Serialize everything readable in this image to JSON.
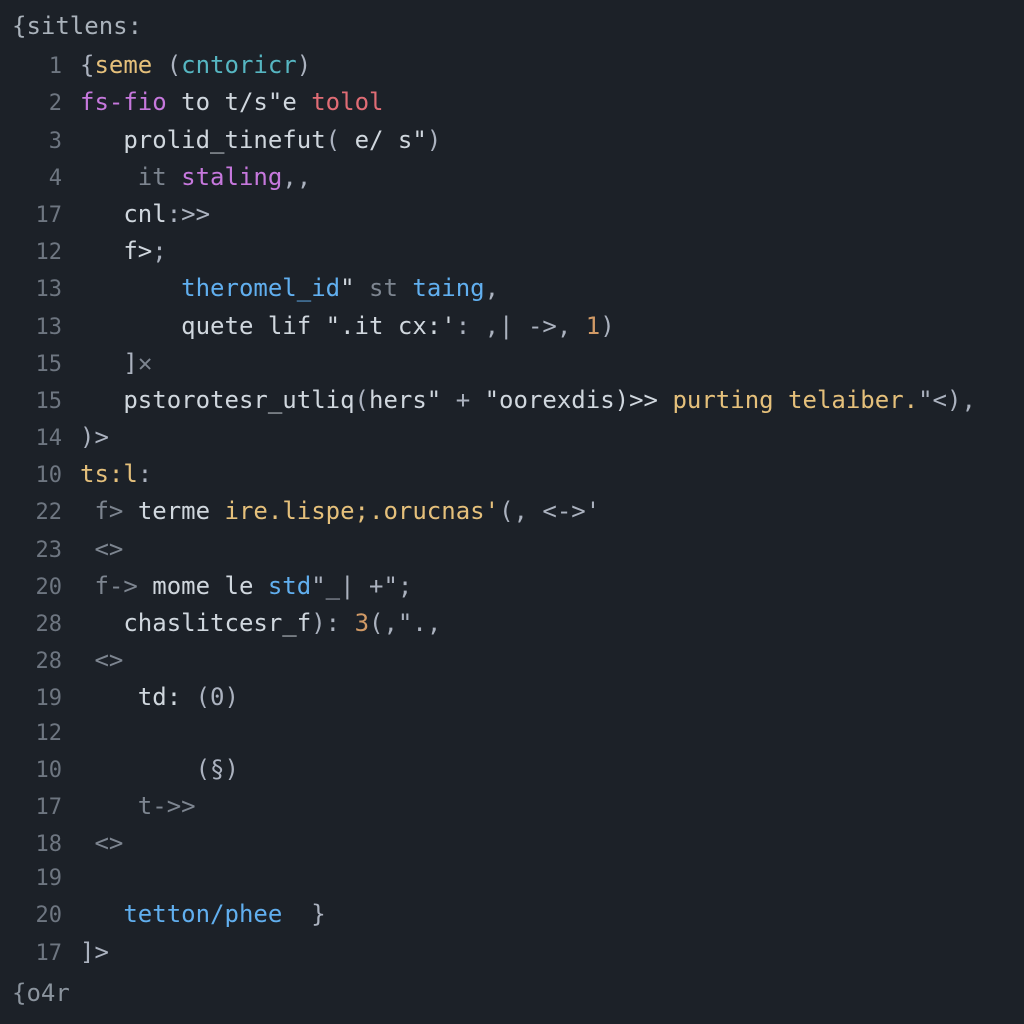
{
  "header": "{sitlens:",
  "footer": "{o4r",
  "lines": [
    {
      "num": "1",
      "indent": "",
      "tokens": [
        {
          "t": "{",
          "cls": "tk-punc"
        },
        {
          "t": "seme ",
          "cls": "tk-fn"
        },
        {
          "t": "(",
          "cls": "tk-punc"
        },
        {
          "t": "cntoricr",
          "cls": "tk-teal"
        },
        {
          "t": ")",
          "cls": "tk-punc"
        }
      ]
    },
    {
      "num": "2",
      "indent": "",
      "tokens": [
        {
          "t": "fs-fio ",
          "cls": "tk-kw"
        },
        {
          "t": "to ",
          "cls": "tk-default"
        },
        {
          "t": "t/s\"e ",
          "cls": "tk-default"
        },
        {
          "t": "tolol",
          "cls": "tk-err"
        }
      ]
    },
    {
      "num": "3",
      "indent": "   ",
      "tokens": [
        {
          "t": "prolid_tinefut",
          "cls": "tk-default"
        },
        {
          "t": "( ",
          "cls": "tk-punc"
        },
        {
          "t": "e/ ",
          "cls": "tk-default"
        },
        {
          "t": "s\"",
          "cls": "tk-default"
        },
        {
          "t": ")",
          "cls": "tk-punc"
        }
      ]
    },
    {
      "num": "4",
      "indent": "    ",
      "tokens": [
        {
          "t": "it ",
          "cls": "tk-dim"
        },
        {
          "t": "staling",
          "cls": "tk-kw"
        },
        {
          "t": ",,",
          "cls": "tk-punc"
        }
      ]
    },
    {
      "num": "17",
      "indent": "   ",
      "tokens": [
        {
          "t": "cnl",
          "cls": "tk-default"
        },
        {
          "t": ":>>",
          "cls": "tk-punc"
        }
      ]
    },
    {
      "num": "12",
      "indent": "   ",
      "tokens": [
        {
          "t": "f>",
          "cls": "tk-default"
        },
        {
          "t": ";",
          "cls": "tk-punc"
        }
      ]
    },
    {
      "num": "13",
      "indent": "       ",
      "tokens": [
        {
          "t": "theromel_id",
          "cls": "tk-blue"
        },
        {
          "t": "\" ",
          "cls": "tk-default"
        },
        {
          "t": "st ",
          "cls": "tk-dim"
        },
        {
          "t": "taing",
          "cls": "tk-blue"
        },
        {
          "t": ",",
          "cls": "tk-punc"
        }
      ]
    },
    {
      "num": "13",
      "indent": "       ",
      "tokens": [
        {
          "t": "quete lif ",
          "cls": "tk-default"
        },
        {
          "t": "\".it cx:'",
          "cls": "tk-default"
        },
        {
          "t": ": ,| ->, ",
          "cls": "tk-punc"
        },
        {
          "t": "1",
          "cls": "tk-num"
        },
        {
          "t": ")",
          "cls": "tk-punc"
        }
      ]
    },
    {
      "num": "15",
      "indent": "   ",
      "tokens": [
        {
          "t": "]",
          "cls": "tk-punc"
        },
        {
          "t": "✕",
          "cls": "tk-dim"
        }
      ]
    },
    {
      "num": "15",
      "indent": "   ",
      "tokens": [
        {
          "t": "pstorotesr_utliq",
          "cls": "tk-default"
        },
        {
          "t": "(",
          "cls": "tk-punc"
        },
        {
          "t": "hers\"",
          "cls": "tk-default"
        },
        {
          "t": " + ",
          "cls": "tk-punc"
        },
        {
          "t": "\"oorexdis)>> ",
          "cls": "tk-default"
        },
        {
          "t": "purting telaiber.",
          "cls": "tk-fn"
        },
        {
          "t": "\"<),",
          "cls": "tk-punc"
        }
      ]
    },
    {
      "num": "14",
      "indent": "",
      "tokens": [
        {
          "t": ")>",
          "cls": "tk-punc"
        }
      ]
    },
    {
      "num": "10",
      "indent": "",
      "tokens": [
        {
          "t": "ts:l",
          "cls": "tk-fn"
        },
        {
          "t": ":",
          "cls": "tk-punc"
        }
      ]
    },
    {
      "num": "22",
      "indent": " ",
      "tokens": [
        {
          "t": "f> ",
          "cls": "tk-dim"
        },
        {
          "t": "terme ",
          "cls": "tk-default"
        },
        {
          "t": "ire.lispe;.orucnas'",
          "cls": "tk-fn"
        },
        {
          "t": "(, <->'",
          "cls": "tk-punc"
        }
      ]
    },
    {
      "num": "23",
      "indent": " ",
      "tokens": [
        {
          "t": "<>",
          "cls": "tk-dim"
        }
      ]
    },
    {
      "num": "20",
      "indent": " ",
      "tokens": [
        {
          "t": "f-> ",
          "cls": "tk-dim"
        },
        {
          "t": "mome le ",
          "cls": "tk-default"
        },
        {
          "t": "std",
          "cls": "tk-blue"
        },
        {
          "t": "\"_| +\";",
          "cls": "tk-punc"
        }
      ]
    },
    {
      "num": "28",
      "indent": "   ",
      "tokens": [
        {
          "t": "chaslitcesr_f",
          "cls": "tk-default"
        },
        {
          "t": "): ",
          "cls": "tk-punc"
        },
        {
          "t": "3",
          "cls": "tk-num"
        },
        {
          "t": "(,\".,",
          "cls": "tk-punc"
        }
      ]
    },
    {
      "num": "28",
      "indent": " ",
      "tokens": [
        {
          "t": "<>",
          "cls": "tk-dim"
        }
      ]
    },
    {
      "num": "19",
      "indent": "    ",
      "tokens": [
        {
          "t": "td: ",
          "cls": "tk-default"
        },
        {
          "t": "(0)",
          "cls": "tk-punc"
        }
      ]
    },
    {
      "num": "12",
      "indent": "",
      "tokens": []
    },
    {
      "num": "10",
      "indent": "        ",
      "tokens": [
        {
          "t": "(§)",
          "cls": "tk-punc"
        }
      ]
    },
    {
      "num": "17",
      "indent": "    ",
      "tokens": [
        {
          "t": "t->>",
          "cls": "tk-dim"
        }
      ]
    },
    {
      "num": "18",
      "indent": " ",
      "tokens": [
        {
          "t": "<>",
          "cls": "tk-dim"
        }
      ]
    },
    {
      "num": "19",
      "indent": "",
      "tokens": []
    },
    {
      "num": "20",
      "indent": "   ",
      "tokens": [
        {
          "t": "tetton/phee  ",
          "cls": "tk-blue"
        },
        {
          "t": "}",
          "cls": "tk-punc"
        }
      ]
    },
    {
      "num": "17",
      "indent": "",
      "tokens": [
        {
          "t": "]>",
          "cls": "tk-punc"
        }
      ]
    }
  ]
}
